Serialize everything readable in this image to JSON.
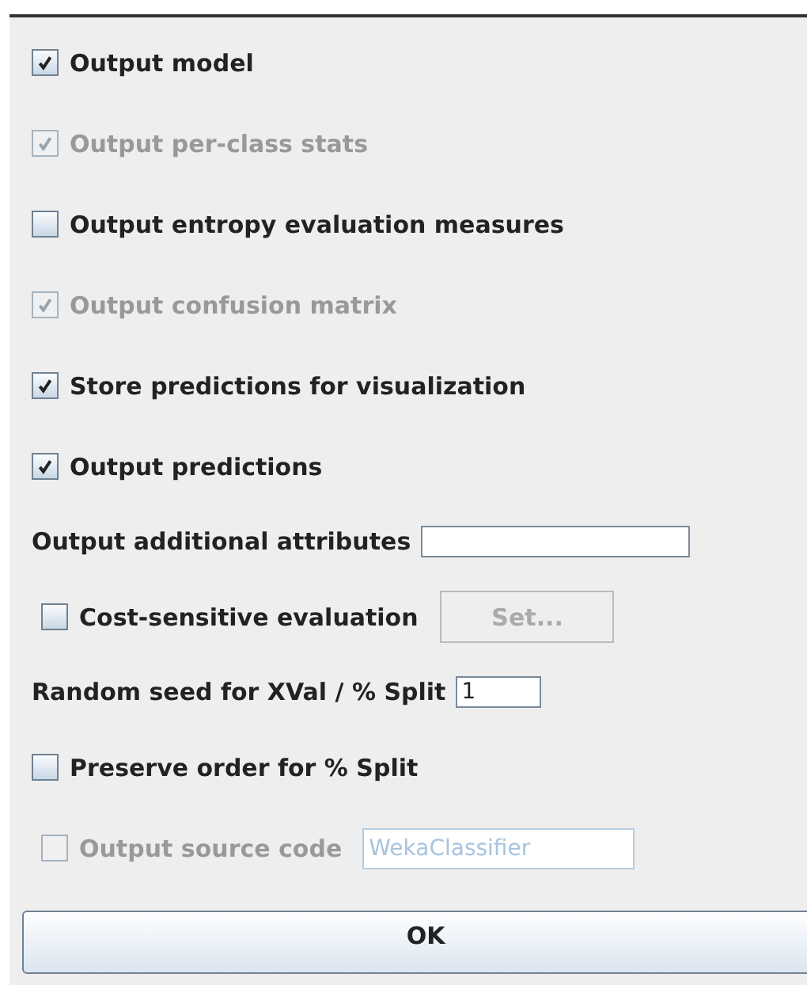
{
  "options": [
    {
      "kind": "checkbox",
      "label": "Output model",
      "checked": true,
      "disabled": false
    },
    {
      "kind": "checkbox",
      "label": "Output per-class stats",
      "checked": true,
      "disabled": true
    },
    {
      "kind": "checkbox",
      "label": "Output entropy evaluation measures",
      "checked": false,
      "disabled": false
    },
    {
      "kind": "checkbox",
      "label": "Output confusion matrix",
      "checked": true,
      "disabled": true
    },
    {
      "kind": "checkbox",
      "label": "Store predictions for visualization",
      "checked": true,
      "disabled": false
    },
    {
      "kind": "checkbox",
      "label": "Output predictions",
      "checked": true,
      "disabled": false
    },
    {
      "kind": "field",
      "label": "Output additional attributes"
    },
    {
      "kind": "checkbox_button",
      "label": "Cost-sensitive evaluation",
      "checked": false,
      "disabled": false,
      "button": {
        "label": "Set...",
        "disabled": true
      }
    },
    {
      "kind": "field",
      "label": "Random seed for XVal / % Split",
      "value": "1"
    },
    {
      "kind": "checkbox",
      "label": "Preserve order for % Split",
      "checked": false,
      "disabled": false
    },
    {
      "kind": "checkbox_field",
      "label": "Output source code",
      "checked": false,
      "disabled": true,
      "value": "WekaClassifier"
    }
  ],
  "ok_button": {
    "label": "OK"
  }
}
